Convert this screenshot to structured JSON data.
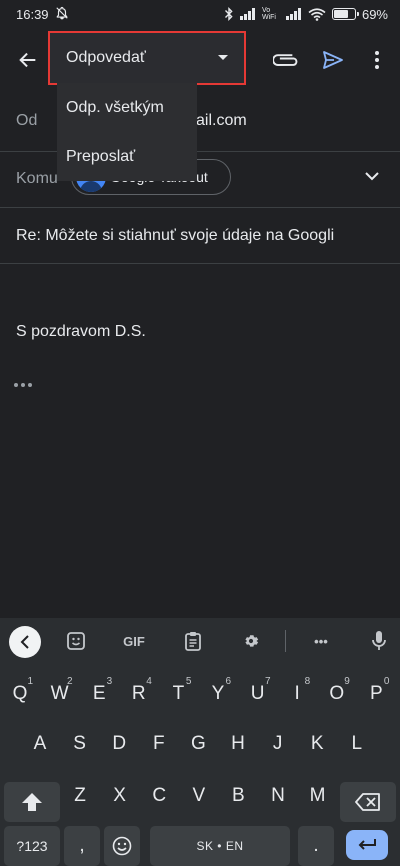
{
  "status_bar": {
    "time": "16:39",
    "network_label": "Vo WiFi",
    "battery_percent": "69%",
    "battery_level": 0.69
  },
  "app_bar": {
    "back_icon": "arrow-left-icon",
    "attach_icon": "paperclip-icon",
    "send_icon": "send-icon",
    "more_icon": "more-vertical-icon"
  },
  "reply_dropdown": {
    "selected": "Odpovedať",
    "options": [
      "Odp. všetkým",
      "Preposlať"
    ],
    "highlight_color": "#e53935"
  },
  "compose": {
    "from_label": "Od",
    "from_value": "ail.com",
    "to_label": "Komu",
    "to_chip": "Google Takeout",
    "subject": "Re: Môžete si stiahnuť svoje údaje na Googli",
    "body": "S pozdravom D.S."
  },
  "keyboard": {
    "toolbar": {
      "gif_label": "GIF",
      "more_label": "•••"
    },
    "row1": [
      {
        "key": "Q",
        "hint": "1"
      },
      {
        "key": "W",
        "hint": "2"
      },
      {
        "key": "E",
        "hint": "3"
      },
      {
        "key": "R",
        "hint": "4"
      },
      {
        "key": "T",
        "hint": "5"
      },
      {
        "key": "Y",
        "hint": "6"
      },
      {
        "key": "U",
        "hint": "7"
      },
      {
        "key": "I",
        "hint": "8"
      },
      {
        "key": "O",
        "hint": "9"
      },
      {
        "key": "P",
        "hint": "0"
      }
    ],
    "row2": [
      "A",
      "S",
      "D",
      "F",
      "G",
      "H",
      "J",
      "K",
      "L"
    ],
    "row3": [
      "Z",
      "X",
      "C",
      "V",
      "B",
      "N",
      "M"
    ],
    "symbols_label": "?123",
    "comma_label": ",",
    "space_label": "SK • EN",
    "period_label": "."
  }
}
